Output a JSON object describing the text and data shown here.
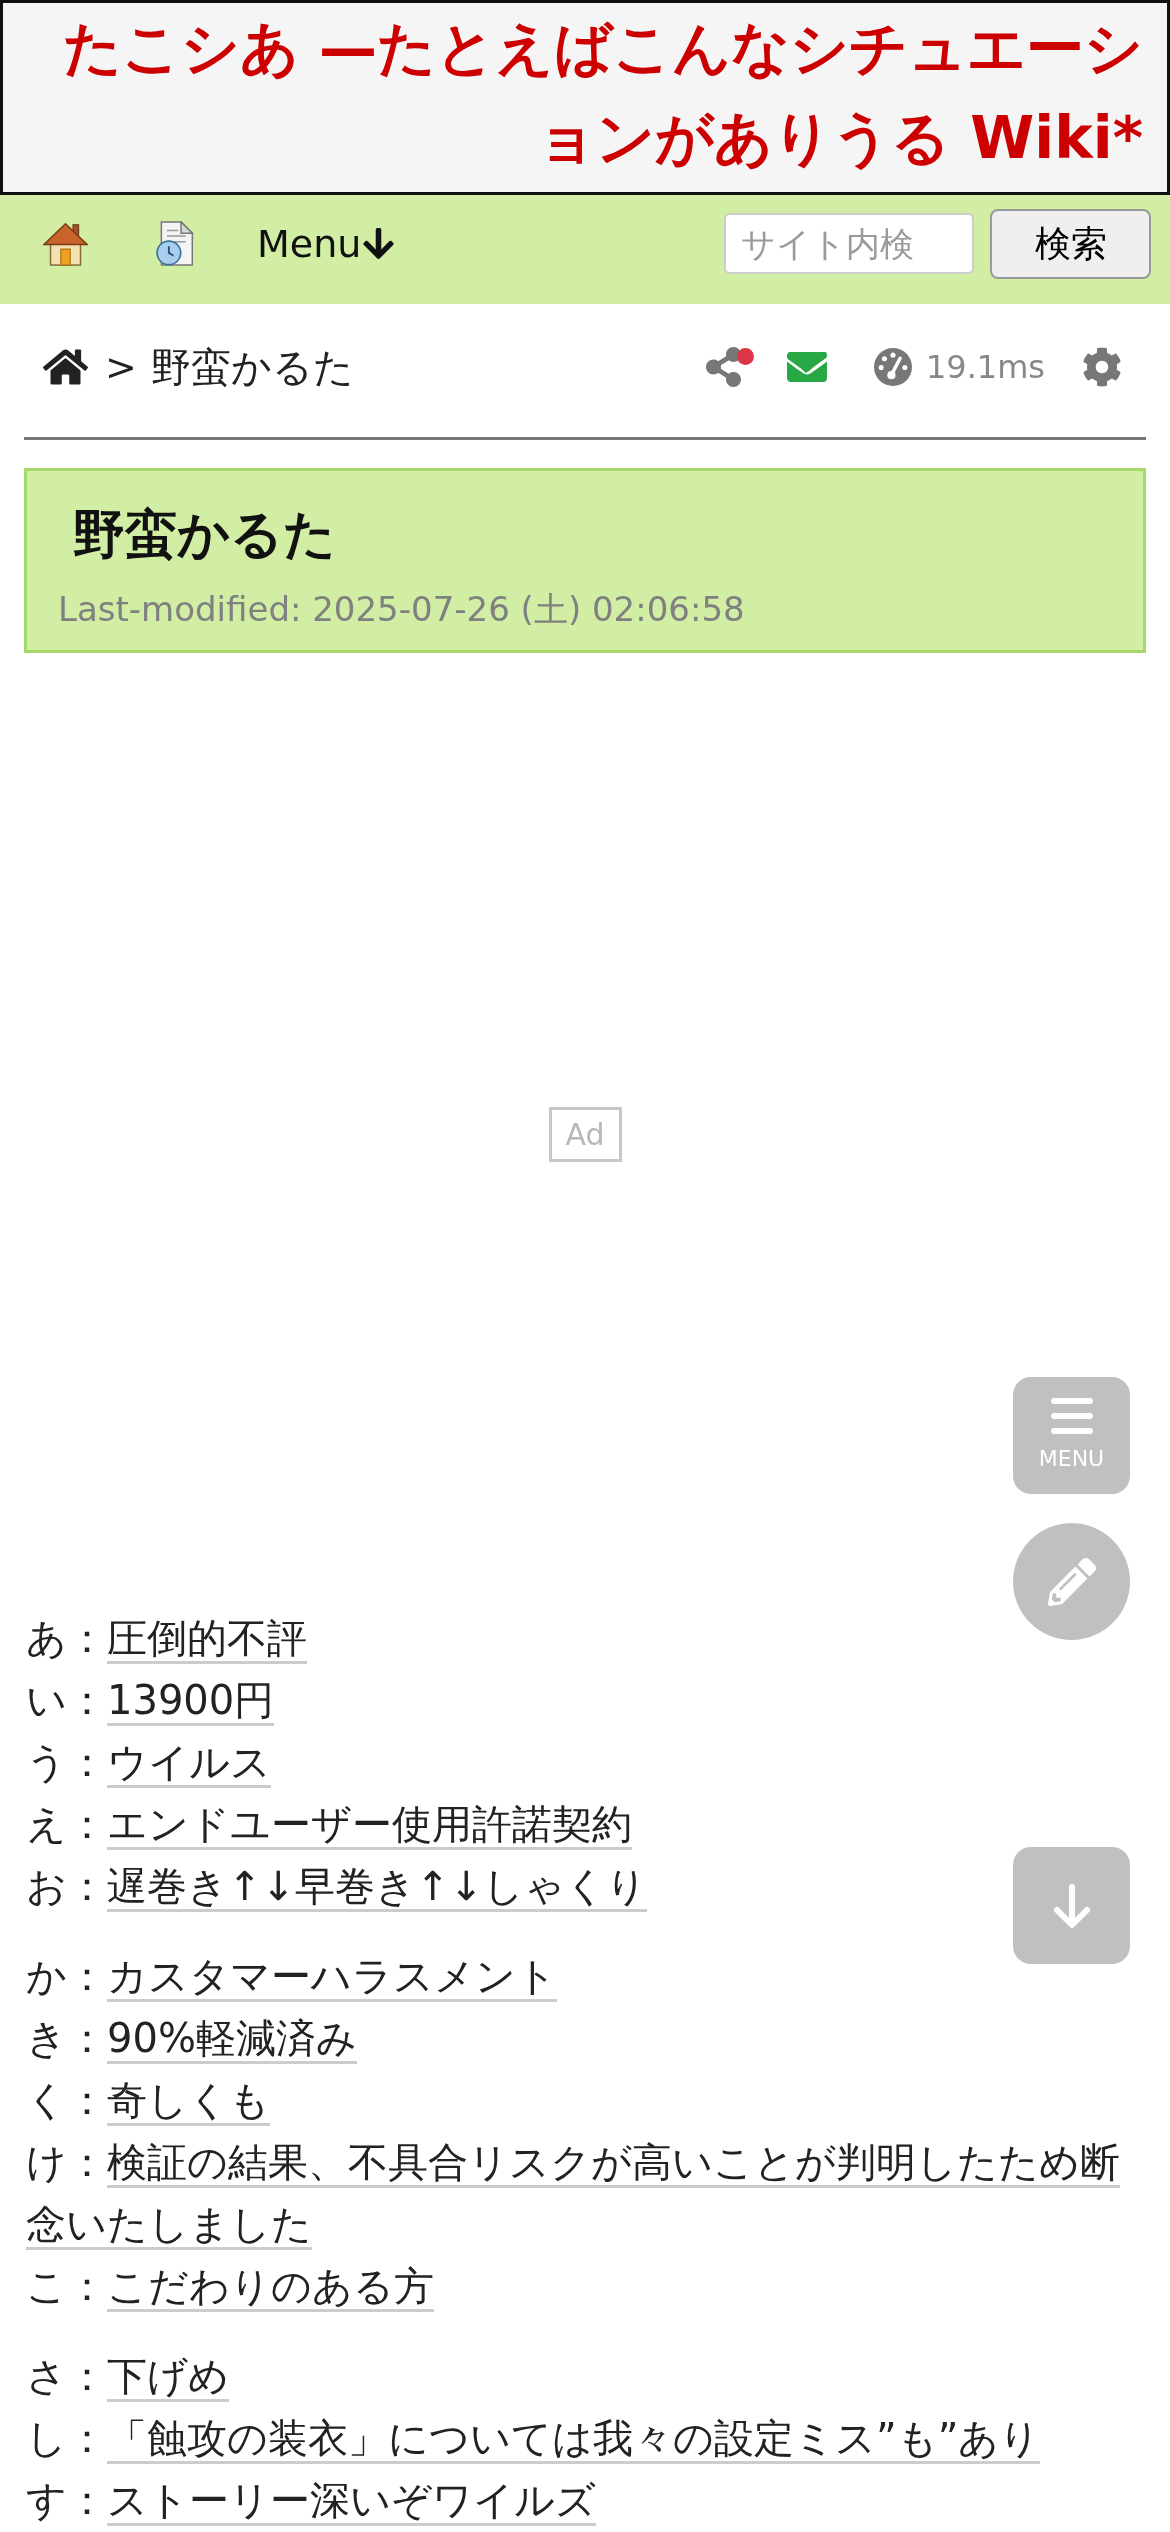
{
  "header": {
    "title": "たこシあ —たとえばこんなシチュエーションがありうる Wiki*"
  },
  "nav": {
    "menu_label": "Menu",
    "search": {
      "placeholder": "サイト内検",
      "button": "検索"
    }
  },
  "breadcrumb": {
    "separator": ">",
    "current": "野蛮かるた",
    "share_badge": true,
    "timing": "19.1ms"
  },
  "page": {
    "title": "野蛮かるた",
    "last_modified": "Last-modified: 2025-07-26 (土) 02:06:58"
  },
  "ad": {
    "label": "Ad"
  },
  "floating_buttons": {
    "menu_label": "MENU"
  },
  "karuta": {
    "groups": [
      {
        "items": [
          {
            "label": "あ：",
            "link": "圧倒的不評"
          },
          {
            "label": "い：",
            "link": "13900円"
          },
          {
            "label": "う：",
            "link": "ウイルス"
          },
          {
            "label": "え：",
            "link": "エンドユーザー使用許諾契約"
          },
          {
            "label": "お：",
            "link": "遅巻き↑↓早巻き↑↓しゃくり"
          }
        ]
      },
      {
        "items": [
          {
            "label": "か：",
            "link": "カスタマーハラスメント"
          },
          {
            "label": "き：",
            "link": "90%軽減済み"
          },
          {
            "label": "く：",
            "link": "奇しくも"
          },
          {
            "label": "け：",
            "link": "検証の結果、不具合リスクが高いことが判明したため断念いたしました"
          },
          {
            "label": "こ：",
            "link": "こだわりのある方"
          }
        ]
      },
      {
        "items": [
          {
            "label": "さ：",
            "link": "下げめ"
          },
          {
            "label": "し：",
            "link": "「蝕攻の装衣」については我々の設定ミス”も”あり"
          },
          {
            "label": "す：",
            "link": "ストーリー深いぞワイルズ"
          }
        ]
      }
    ]
  }
}
